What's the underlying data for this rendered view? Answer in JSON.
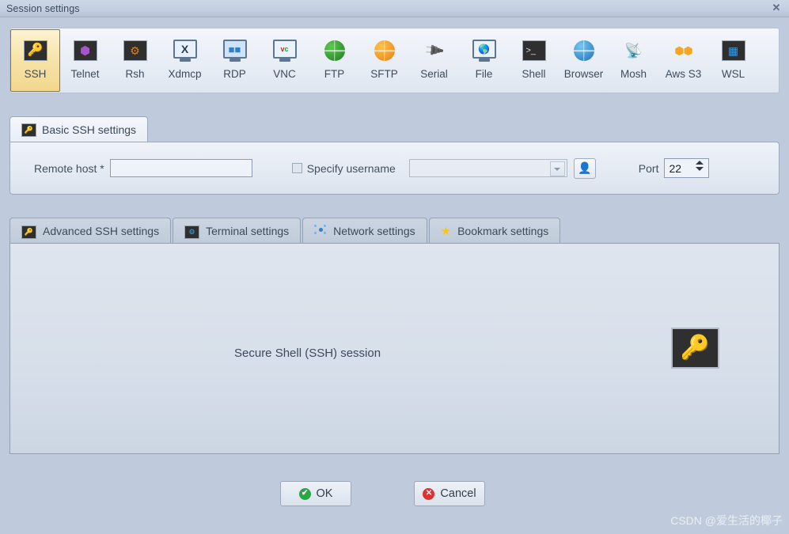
{
  "window": {
    "title": "Session settings",
    "close_label": "✕"
  },
  "protocols": [
    {
      "label": "SSH",
      "icon": "ssh-key-icon",
      "selected": true
    },
    {
      "label": "Telnet",
      "icon": "telnet-cube-icon",
      "selected": false
    },
    {
      "label": "Rsh",
      "icon": "rsh-gears-icon",
      "selected": false
    },
    {
      "label": "Xdmcp",
      "icon": "xdmcp-x-icon",
      "selected": false
    },
    {
      "label": "RDP",
      "icon": "rdp-windows-icon",
      "selected": false
    },
    {
      "label": "VNC",
      "icon": "vnc-monitor-icon",
      "selected": false
    },
    {
      "label": "FTP",
      "icon": "ftp-globe-icon",
      "selected": false
    },
    {
      "label": "SFTP",
      "icon": "sftp-globe-icon",
      "selected": false
    },
    {
      "label": "Serial",
      "icon": "serial-plug-icon",
      "selected": false
    },
    {
      "label": "File",
      "icon": "file-monitor-icon",
      "selected": false
    },
    {
      "label": "Shell",
      "icon": "shell-prompt-icon",
      "selected": false
    },
    {
      "label": "Browser",
      "icon": "browser-globe-icon",
      "selected": false
    },
    {
      "label": "Mosh",
      "icon": "mosh-dish-icon",
      "selected": false
    },
    {
      "label": "Aws S3",
      "icon": "aws-cubes-icon",
      "selected": false
    },
    {
      "label": "WSL",
      "icon": "wsl-windows-icon",
      "selected": false
    }
  ],
  "basic": {
    "tab_label": "Basic SSH settings",
    "tab_icon": "ssh-key-icon",
    "remote_host_label": "Remote host *",
    "remote_host_value": "",
    "remote_host_placeholder": "",
    "specify_username_label": "Specify username",
    "specify_username_checked": false,
    "username_value": "",
    "username_placeholder": "",
    "user_key_button_icon": "user-key-icon",
    "port_label": "Port",
    "port_value": "22"
  },
  "secondary_tabs": [
    {
      "label": "Advanced SSH settings",
      "icon": "ssh-key-icon"
    },
    {
      "label": "Terminal settings",
      "icon": "terminal-gear-icon"
    },
    {
      "label": "Network settings",
      "icon": "network-dots-icon"
    },
    {
      "label": "Bookmark settings",
      "icon": "bookmark-star-icon"
    }
  ],
  "content": {
    "description": "Secure Shell (SSH) session",
    "image_icon": "ssh-key-large-icon"
  },
  "footer": {
    "ok_label": "OK",
    "ok_icon": "check-circle-icon",
    "ok_mark": "✔",
    "cancel_label": "Cancel",
    "cancel_icon": "x-circle-icon",
    "cancel_mark": "✕"
  },
  "watermark": "CSDN @爱生活的椰子",
  "colors": {
    "dialog_bg": "#bfcbdd",
    "selected_tab": "#f7e3a8",
    "accent_key": "#f5c518",
    "ok_green": "#28a745",
    "cancel_red": "#e03131"
  }
}
